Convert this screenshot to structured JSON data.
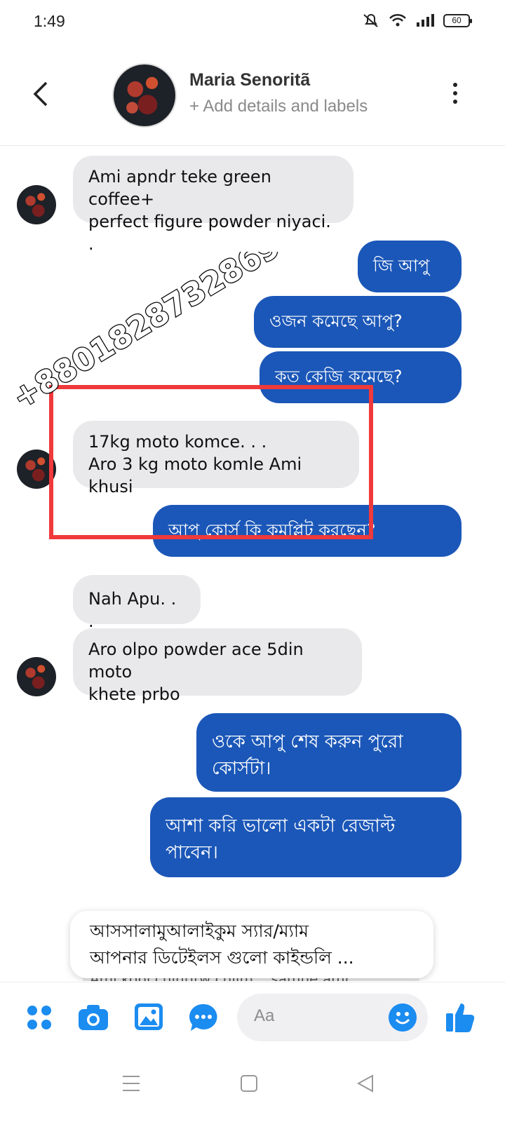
{
  "status": {
    "time": "1:49",
    "battery": "60"
  },
  "header": {
    "name": "Maria Senoritã",
    "subtitle": "+ Add details and labels"
  },
  "messages": [
    {
      "dir": "in",
      "lines": [
        "Ami apndr teke green coffee+",
        "perfect figure powder niyaci. ."
      ]
    },
    {
      "dir": "out",
      "lines": [
        "জি আপু"
      ]
    },
    {
      "dir": "out",
      "lines": [
        "ওজন কমেছে আপু?"
      ]
    },
    {
      "dir": "out",
      "lines": [
        "কত কেজি কমেছে?"
      ]
    },
    {
      "dir": "in",
      "lines": [
        "17kg moto komce. . .",
        "Aro 3 kg moto komle Ami khusi"
      ]
    },
    {
      "dir": "out",
      "lines": [
        "আপু কোর্স কি কমপ্লিট করছেন?"
      ]
    },
    {
      "dir": "in",
      "lines": [
        "Nah Apu. . ."
      ]
    },
    {
      "dir": "in",
      "lines": [
        "Aro olpo powder ace 5din moto",
        "khete prbo"
      ]
    },
    {
      "dir": "out",
      "lines": [
        "ওকে আপু শেষ করুন পুরো",
        "কোর্সটা।"
      ]
    },
    {
      "dir": "out",
      "lines": [
        "আশা করি ভালো একটা রেজাল্ট",
        "পাবেন।"
      ]
    }
  ],
  "watermark": "+8801828732869",
  "suggestion": {
    "line1": "আসসালামুআলাইকুম স্যার/ম্যাম",
    "line2": "আপনার ডিটেইলস গুলো কাইন্ডলি ..."
  },
  "peek_text": "Ami kobi chintitw chilm. . samne amr",
  "composer": {
    "placeholder": "Aa"
  },
  "colors": {
    "accent": "#1b57b8",
    "icon_blue": "#1b8cf0",
    "highlight": "#f0393b"
  }
}
